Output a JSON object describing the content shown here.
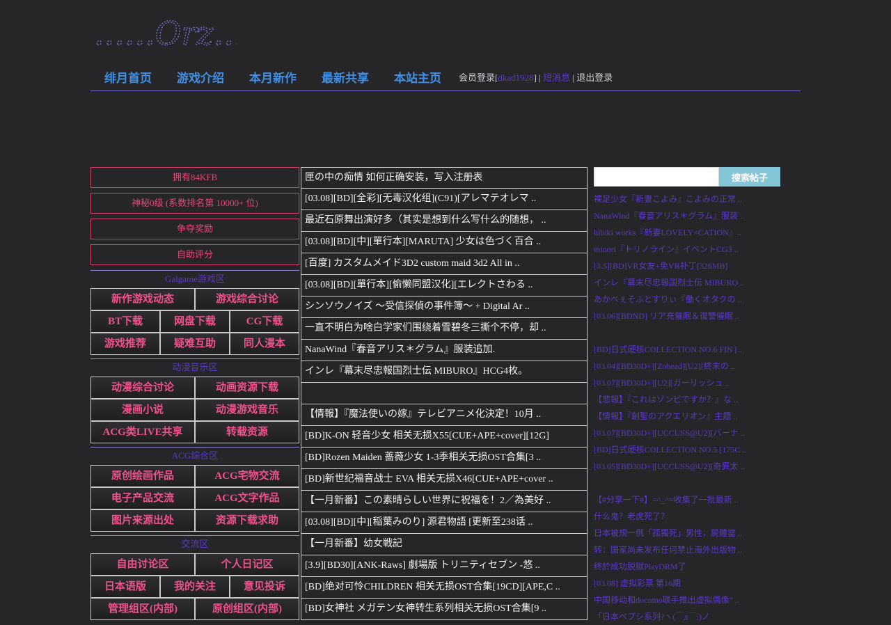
{
  "logo": {
    "text": "......Orz......."
  },
  "nav": [
    "绯月首页",
    "游戏介绍",
    "本月新作",
    "最新共享",
    "本站主页"
  ],
  "userbar": {
    "login_label": "会员登录[",
    "username": "dkad1928",
    "sep1": "] | ",
    "messages": "短消息",
    "sep2": " | ",
    "logout": "退出登录"
  },
  "left": {
    "pink_boxes": [
      "拥有84KFB",
      "神秘0级 (系数排名第 10000+ 位)",
      "争夺奖励",
      "自助评分"
    ],
    "sections": [
      {
        "title": "Galgame游戏区",
        "rows": [
          [
            "新作游戏动态",
            "游戏综合讨论"
          ],
          [
            "BT下载",
            "网盘下载",
            "CG下载"
          ],
          [
            "游戏推荐",
            "疑难互助",
            "同人漫本"
          ]
        ]
      },
      {
        "title": "动漫音乐区",
        "rows": [
          [
            "动漫综合讨论",
            "动画资源下载"
          ],
          [
            "漫画小说",
            "动漫游戏音乐"
          ],
          [
            "ACG类LIVE共享",
            "转载资源"
          ]
        ]
      },
      {
        "title": "ACG综合区",
        "rows": [
          [
            "原创绘画作品",
            "ACG宅物交流"
          ],
          [
            "电子产品交流",
            "ACG文字作品"
          ],
          [
            "图片来源出处",
            "资源下载求助"
          ]
        ]
      },
      {
        "title": "交流区",
        "rows": [
          [
            "自由讨论区",
            "个人日记区"
          ],
          [
            "日本语版",
            "我的关注",
            "意见投诉"
          ],
          [
            "管理组区(内部)",
            "原创组区(内部)"
          ]
        ]
      }
    ]
  },
  "middle": [
    "匣の中の痴情 如何正确安装，写入注册表",
    "[03.08][BD][全彩][无毒汉化组](C91)[アレマテオレマ ..",
    "最近石原舞出演好多（其实是想到什么写什么的随想， ..",
    "[03.08][BD][中][單行本][MARUTA] 少女は色づく百合 ..",
    "[百度] カスタムメイド3D2 custom maid 3d2 All in ..",
    "[03.08][BD][單行本][偷懒同盟汉化][エレクトさわる ..",
    "シンソウノイズ ～受信探偵の事件簿～ + Digital Ar ..",
    "一直不明白为啥白学家们围绕着雪碧冬三撕个不停，却 ..",
    "NanaWind『春音アリス＊グラム』服装追加.",
    "インレ『幕末尽忠報国烈士伝 MIBURO』HCG4枚。",
    "",
    "【情報】『魔法使いの嫁』テレビアニメ化決定！10月 ..",
    "[BD]K-ON 轻音少女 相关无损X55[CUE+APE+cover][12G]",
    "[BD]Rozen Maiden 蔷薇少女 1-3季相关无损OST合集[3 ..",
    "[BD]新世纪福音战士 EVA 相关无损X46[CUE+APE+cover ..",
    "【一月新番】この素晴らしい世界に祝福を！2／為美好 ..",
    "[03.08][BD][中][稲葉みのり] 源君物語 [更新至238话 ..",
    "【一月新番】幼女戦記",
    "[3.9][BD30][ANK-Raws] 劇場版 トリニティセブン -悠 ..",
    "[BD]绝对可怜CHILDREN 相关无损OST合集[19CD][APE,C ..",
    "[BD]女神社 メガテン女神转生系列相关无损OST合集[9 .."
  ],
  "right": {
    "search_button": "搜索帖子",
    "groups": [
      [
        "裸足少女『新妻こよみ』こよみの正常 ..",
        "NanaWind『春音アリス＊グラム』服装 ..",
        "hibiki works『新妻LOVELY×CATION』..",
        "minori『トリノライン』イベントCG3 ..",
        "[3.5][BD]VR女友+免VR补丁[326MB]",
        "インレ『幕末尽忠報国烈士伝 MIBURO ..",
        "あかべぇそふとすりぃ『働くオタクの ..",
        "[03.06][BDND] リア充催眠＆復讐催眠 .."
      ],
      [
        "[BD]日式硬核COLLECTION NO.6 FIN [..",
        "[03.04][BD30D+][Zohead][U2][終末の ..",
        "[03.07][BD30D+][U2][ガーリッシュ ..",
        "【悲報】『これはゾンビですか？』な ..",
        "【情報】『創聖のアクエリオン』主題 ..",
        "[03.07][BD30D+][UCCUSS@U2][バーナ ..",
        "[BD]日式硬核COLLECTION NO.5 [175C ..",
        "[03.05][BD30D+][UCCUSS@U2][奇異太 .."
      ],
      [
        "【#分享一下#】=^_^=收集了一批最新 ..",
        "什么鬼？老虎死了？",
        "日本被規一例「孤獨死」男性，屍體當 ..",
        "转：国家尚未发布任何禁止海外出版物 ..",
        "终於成功脱獄PlayDRM了",
        "[03.08] 虚拟彩票 第16期",
        "中国移动和docomo联手推出虚拟偶像“ ..",
        "「日本ペプシ系列?ヽ(￣д￣;)ノ"
      ]
    ]
  },
  "colors": {
    "accent": "#3f8fe6",
    "pink": "#f0518a",
    "purple": "#5a39c6",
    "bg": "#262628"
  }
}
